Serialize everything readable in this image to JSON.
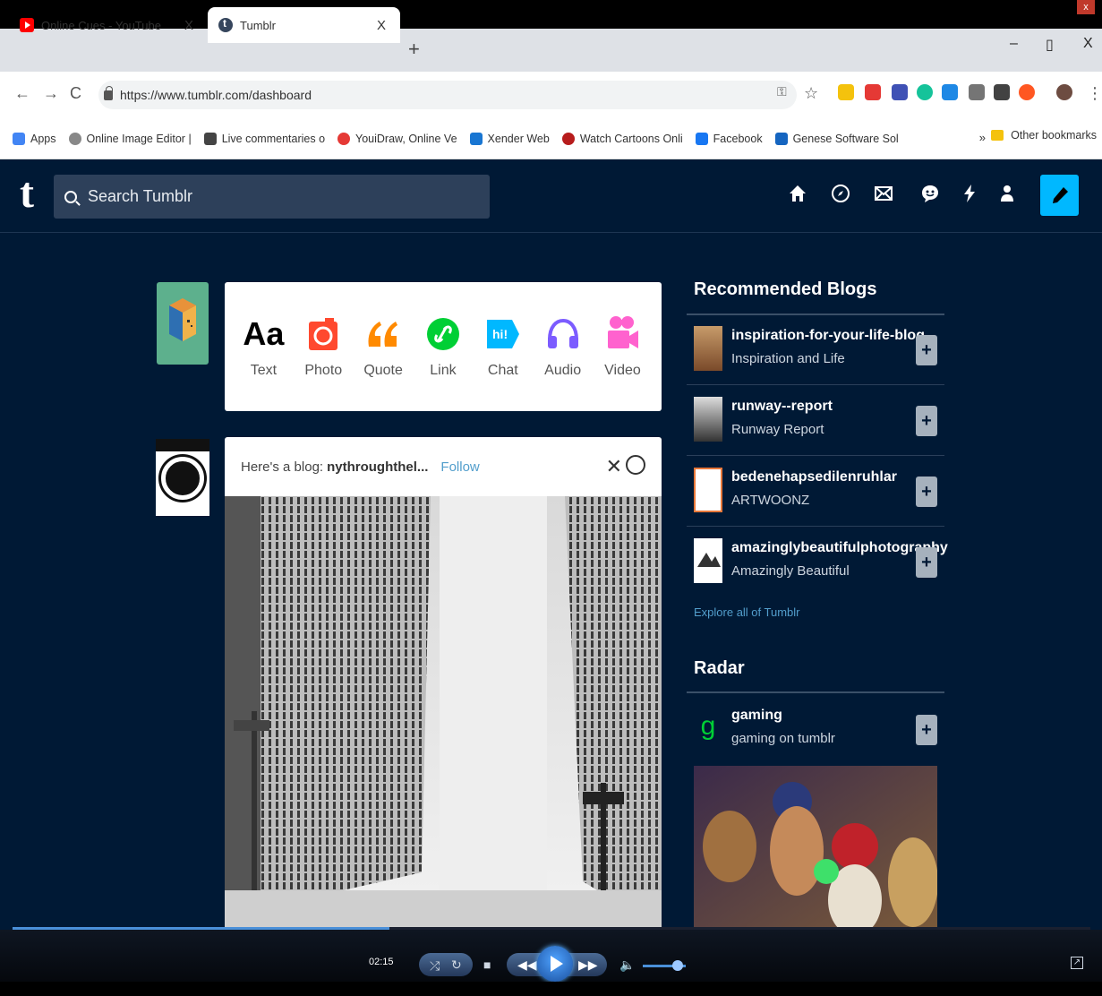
{
  "browser": {
    "tabs": [
      {
        "title": "Online Cues - YouTube",
        "active": false
      },
      {
        "title": "Tumblr",
        "active": true
      }
    ],
    "tab_close": "X",
    "new_tab": "+",
    "window_controls": {
      "minimize": "–",
      "restore": "▯",
      "close": "X"
    },
    "url": "https://www.tumblr.com/dashboard",
    "nav": {
      "back": "←",
      "forward": "→",
      "reload": "C"
    },
    "bookmarks": [
      {
        "label": "Apps",
        "color": "#4285f4"
      },
      {
        "label": "Online Image Editor |",
        "color": "#888888"
      },
      {
        "label": "Live commentaries o",
        "color": "#444444"
      },
      {
        "label": "YouiDraw, Online Ve",
        "color": "#e53935"
      },
      {
        "label": "Xender Web",
        "color": "#1976d2"
      },
      {
        "label": "Watch Cartoons Onli",
        "color": "#b71c1c"
      },
      {
        "label": "Facebook",
        "color": "#1877f2"
      },
      {
        "label": "Genese Software Sol",
        "color": "#1565c0"
      }
    ],
    "bookmarks_more": "»",
    "other_bookmarks": "Other bookmarks"
  },
  "tumblr": {
    "logo": "t",
    "search_placeholder": "Search Tumblr",
    "header_icons": [
      "home-icon",
      "explore-icon",
      "inbox-icon",
      "messaging-icon",
      "activity-icon",
      "account-icon"
    ],
    "post_types": [
      {
        "label": "Text",
        "glyph": "Aa",
        "color": "#000000"
      },
      {
        "label": "Photo",
        "glyph": "◙",
        "color": "#ff492f"
      },
      {
        "label": "Quote",
        "glyph": "66",
        "color": "#ff8a00"
      },
      {
        "label": "Link",
        "glyph": "∂",
        "color": "#00cf35"
      },
      {
        "label": "Chat",
        "glyph": "hi!",
        "color": "#00b8ff"
      },
      {
        "label": "Audio",
        "glyph": "♫",
        "color": "#7c5cff"
      },
      {
        "label": "Video",
        "glyph": "▶",
        "color": "#ff62ce"
      }
    ],
    "recommended_post": {
      "prefix": "Here's a blog:",
      "blog": "nythroughthel...",
      "follow": "Follow",
      "dismiss": "✕"
    },
    "sidebar": {
      "recommended_heading": "Recommended Blogs",
      "blogs": [
        {
          "name": "inspiration-for-your-life-blog",
          "title": "Inspiration and Life"
        },
        {
          "name": "runway--report",
          "title": "Runway Report"
        },
        {
          "name": "bedenehapsedilenruhlar",
          "title": "ARTWOONZ"
        },
        {
          "name": "amazinglybeautifulphotography",
          "title": "Amazingly Beautiful"
        }
      ],
      "explore_link": "Explore all of Tumblr",
      "radar_heading": "Radar",
      "radar_blog": {
        "name": "gaming",
        "title": "gaming on tumblr"
      },
      "follow_symbol": "+"
    }
  },
  "player": {
    "timecode": "02:15",
    "progress": 0.35,
    "volume": 0.75
  },
  "colors": {
    "tumblr_bg": "#001935",
    "accent": "#00b8ff",
    "link": "#529ecc"
  }
}
